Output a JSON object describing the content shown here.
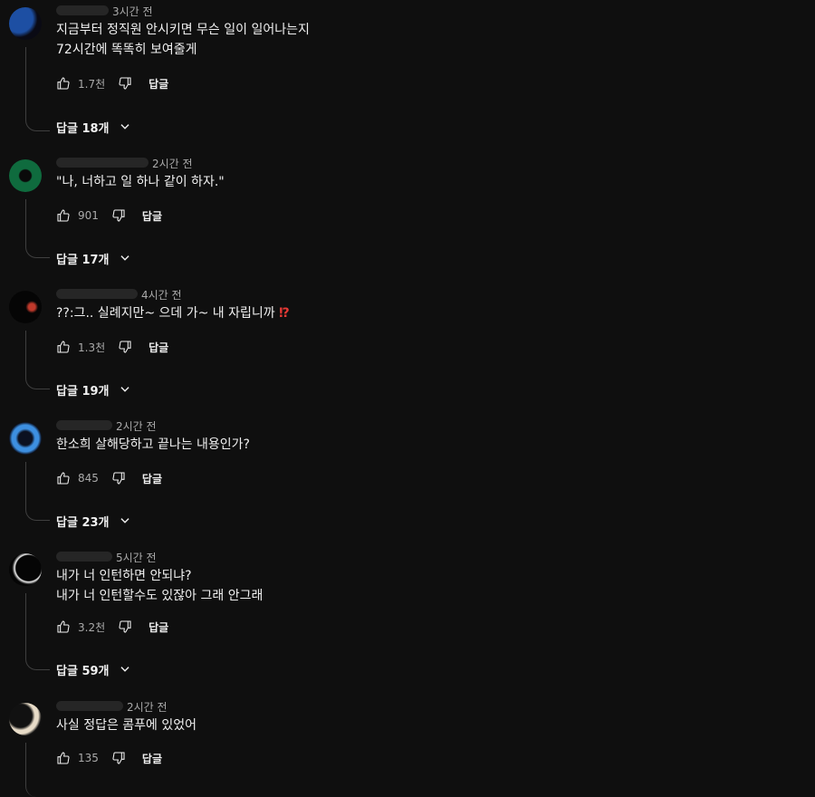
{
  "comments": [
    {
      "time": "3시간 전",
      "text": "지금부터 정직원 안시키면 무슨 일이 일어나는지\n72시간에 똑똑히 보여줄게",
      "likes": "1.7천",
      "reply_label": "답글",
      "replies_label": "답글 18개",
      "avatar_colors": [
        "#1d4fa3",
        "#0a0a14"
      ]
    },
    {
      "time": "2시간 전",
      "text": "\"나, 너하고 일 하나 같이 하자.\"",
      "likes": "901",
      "reply_label": "답글",
      "replies_label": "답글 17개",
      "avatar_colors": [
        "#0f6b3e",
        "#0a0a0a"
      ]
    },
    {
      "time": "4시간 전",
      "text": "??:그.. 실례지만~ 으데 가~ 내 자립니까",
      "emoji": "⁉",
      "likes": "1.3천",
      "reply_label": "답글",
      "replies_label": "답글 19개",
      "avatar_colors": [
        "#c0392b",
        "#050505"
      ]
    },
    {
      "time": "2시간 전",
      "text": "한소희 살해당하고 끝나는 내용인가?",
      "likes": "845",
      "reply_label": "답글",
      "replies_label": "답글 23개",
      "avatar_colors": [
        "#3d8fe0",
        "#0b1020"
      ]
    },
    {
      "time": "5시간 전",
      "text": "내가 너 인턴하면 안되냐?\n내가 너 인턴할수도 있잖아 그래 안그래",
      "likes": "3.2천",
      "reply_label": "답글",
      "replies_label": "답글 59개",
      "avatar_colors": [
        "#f0f0f0",
        "#050505"
      ]
    },
    {
      "time": "2시간 전",
      "text": "사실 정답은 콤푸에 있었어",
      "likes": "135",
      "reply_label": "답글",
      "replies_label": "",
      "avatar_colors": [
        "#e8dcc8",
        "#111111"
      ]
    }
  ]
}
